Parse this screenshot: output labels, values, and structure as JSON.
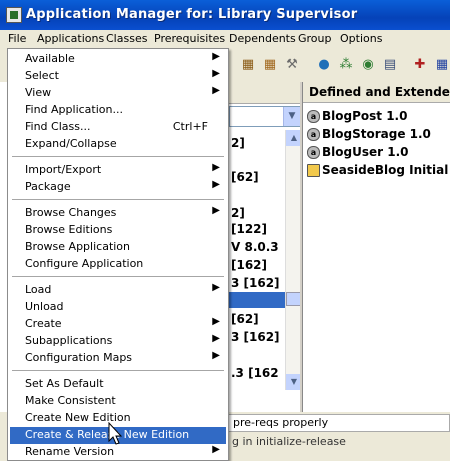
{
  "window": {
    "title": "Application Manager for: Library Supervisor"
  },
  "menubar": [
    "File",
    "Applications",
    "Classes",
    "Prerequisites",
    "Dependents",
    "Group",
    "Options"
  ],
  "menu": {
    "groups": [
      [
        {
          "label": "Available",
          "submenu": true
        },
        {
          "label": "Select",
          "submenu": true
        },
        {
          "label": "View",
          "submenu": true
        },
        {
          "label": "Find Application..."
        },
        {
          "label": "Find Class...",
          "shortcut": "Ctrl+F"
        },
        {
          "label": "Expand/Collapse"
        }
      ],
      [
        {
          "label": "Import/Export",
          "submenu": true
        },
        {
          "label": "Package",
          "submenu": true
        }
      ],
      [
        {
          "label": "Browse Changes",
          "submenu": true
        },
        {
          "label": "Browse Editions"
        },
        {
          "label": "Browse Application"
        },
        {
          "label": "Configure Application"
        }
      ],
      [
        {
          "label": "Load",
          "submenu": true
        },
        {
          "label": "Unload"
        },
        {
          "label": "Create",
          "submenu": true
        },
        {
          "label": "Subapplications",
          "submenu": true
        },
        {
          "label": "Configuration Maps",
          "submenu": true
        }
      ],
      [
        {
          "label": "Set As Default"
        },
        {
          "label": "Make Consistent"
        },
        {
          "label": "Create New Edition"
        },
        {
          "label": "Create & Release New Edition",
          "highlighted": true
        },
        {
          "label": "Rename Version",
          "submenu": true
        }
      ]
    ]
  },
  "left_fragments": [
    "2]",
    "[62]",
    "2]",
    "[122]",
    "V 8.0.3",
    "[162]",
    "3  [162]",
    "[62]",
    "3  [162]",
    ".3  [162"
  ],
  "right_pane": {
    "header": "Defined and Extended",
    "items": [
      {
        "label": "BlogPost 1.0",
        "icon": "app-icon"
      },
      {
        "label": "BlogStorage 1.0",
        "icon": "app-icon"
      },
      {
        "label": "BlogUser 1.0",
        "icon": "app-icon"
      },
      {
        "label": "SeasideBlog Initial",
        "icon": "folder-icon"
      }
    ]
  },
  "status": {
    "line1": "pre-reqs properly",
    "line2": "g in initialize-release"
  },
  "colors": {
    "title_bar": "#0542b8",
    "highlight": "#316ac5"
  }
}
